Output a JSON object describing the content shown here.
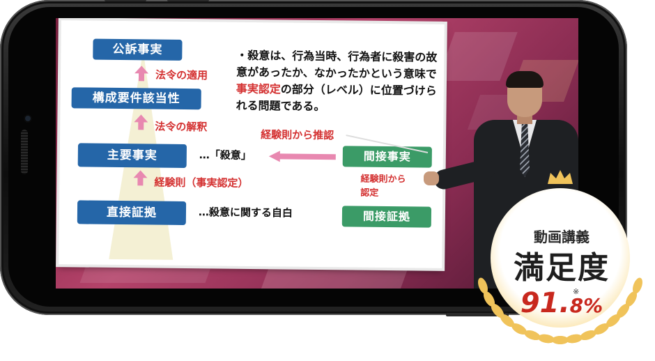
{
  "slide": {
    "boxes": {
      "koso": "公訴事実",
      "kosei": "構成要件該当性",
      "shuyo": "主要事実",
      "chokusetsu": "直接証拠",
      "kansetsu_jijitsu": "間接事実",
      "kansetsu_shoko": "間接証拠"
    },
    "labels": {
      "horei_tekiyo": "法令の適用",
      "horei_kaishaku": "法令の解釈",
      "keikensoku_nintei": "経験則（事実認定）",
      "keikensoku_suinin": "経験則から推認",
      "keikensoku_partial": "経験則から",
      "nintei": "認定",
      "satsui_quote": "…「殺意」",
      "satsui_jihaku": "…殺意に関する自白"
    },
    "bullet": {
      "lead": "・殺意は、行為当時、行為者に殺害の故意があったか、なかったかという意味で",
      "highlight": "事実認定",
      "tail": "の部分（レベル）に位置づけられる問題である。"
    }
  },
  "badge": {
    "line1": "動画講義",
    "line2": "満足度",
    "value_big": "91.",
    "value_small": "8%",
    "note_mark": "※"
  },
  "colors": {
    "box_blue": "#2566a8",
    "box_green": "#3b9b67",
    "text_red": "#d43232",
    "arrow_pink": "#e888b0",
    "badge_gold": "#f0c35a",
    "badge_red": "#c8281e"
  }
}
